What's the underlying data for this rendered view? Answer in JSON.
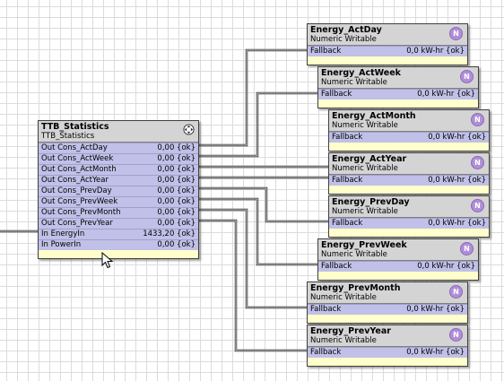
{
  "stats": {
    "title": "TTB_Statistics",
    "subtitle": "TTB_Statistics",
    "move_icon": "move-icon",
    "rows": [
      {
        "label": "Out Cons_ActDay",
        "value": "0,00 {ok}"
      },
      {
        "label": "Out Cons_ActWeek",
        "value": "0,00 {ok}"
      },
      {
        "label": "Out Cons_ActMonth",
        "value": "0,00 {ok}"
      },
      {
        "label": "Out Cons_ActYear",
        "value": "0,00 {ok}"
      },
      {
        "label": "Out Cons_PrevDay",
        "value": "0,00 {ok}"
      },
      {
        "label": "Out Cons_PrevWeek",
        "value": "0,00 {ok}"
      },
      {
        "label": "Out Cons_PrevMonth",
        "value": "0,00 {ok}"
      },
      {
        "label": "Out Cons_PrevYear",
        "value": "0,00 {ok}"
      },
      {
        "label": "In EnergyIn",
        "value": "1433,20 {ok}"
      },
      {
        "label": "In PowerIn",
        "value": "0,00 {ok}"
      }
    ]
  },
  "energy_blocks": [
    {
      "title": "Energy_ActDay",
      "subtitle": "Numeric Writable",
      "slot": "Fallback",
      "value": "0,0 kW-hr {ok}",
      "badge": "N"
    },
    {
      "title": "Energy_ActWeek",
      "subtitle": "Numeric Writable",
      "slot": "Fallback",
      "value": "0,0 kW-hr {ok}",
      "badge": "N"
    },
    {
      "title": "Energy_ActMonth",
      "subtitle": "Numeric Writable",
      "slot": "Fallback",
      "value": "0,0 kW-hr {ok}",
      "badge": "N"
    },
    {
      "title": "Energy_ActYear",
      "subtitle": "Numeric Writable",
      "slot": "Fallback",
      "value": "0,0 kW-hr {ok}",
      "badge": "N"
    },
    {
      "title": "Energy_PrevDay",
      "subtitle": "Numeric Writable",
      "slot": "Fallback",
      "value": "0,0 kW-hr {ok}",
      "badge": "N"
    },
    {
      "title": "Energy_PrevWeek",
      "subtitle": "Numeric Writable",
      "slot": "Fallback",
      "value": "0,0 kW-hr {ok}",
      "badge": "N"
    },
    {
      "title": "Energy_PrevMonth",
      "subtitle": "Numeric Writable",
      "slot": "Fallback",
      "value": "0,0 kW-hr {ok}",
      "badge": "N"
    },
    {
      "title": "Energy_PrevYear",
      "subtitle": "Numeric Writable",
      "slot": "Fallback",
      "value": "0,0 kW-hr {ok}",
      "badge": "N"
    }
  ],
  "colors": {
    "header_bg": "#d4d4d4",
    "slot_bg": "#c0c0e8",
    "block_bg": "#ffffcc",
    "badge": "#b08fd8",
    "wire": "#303030"
  }
}
